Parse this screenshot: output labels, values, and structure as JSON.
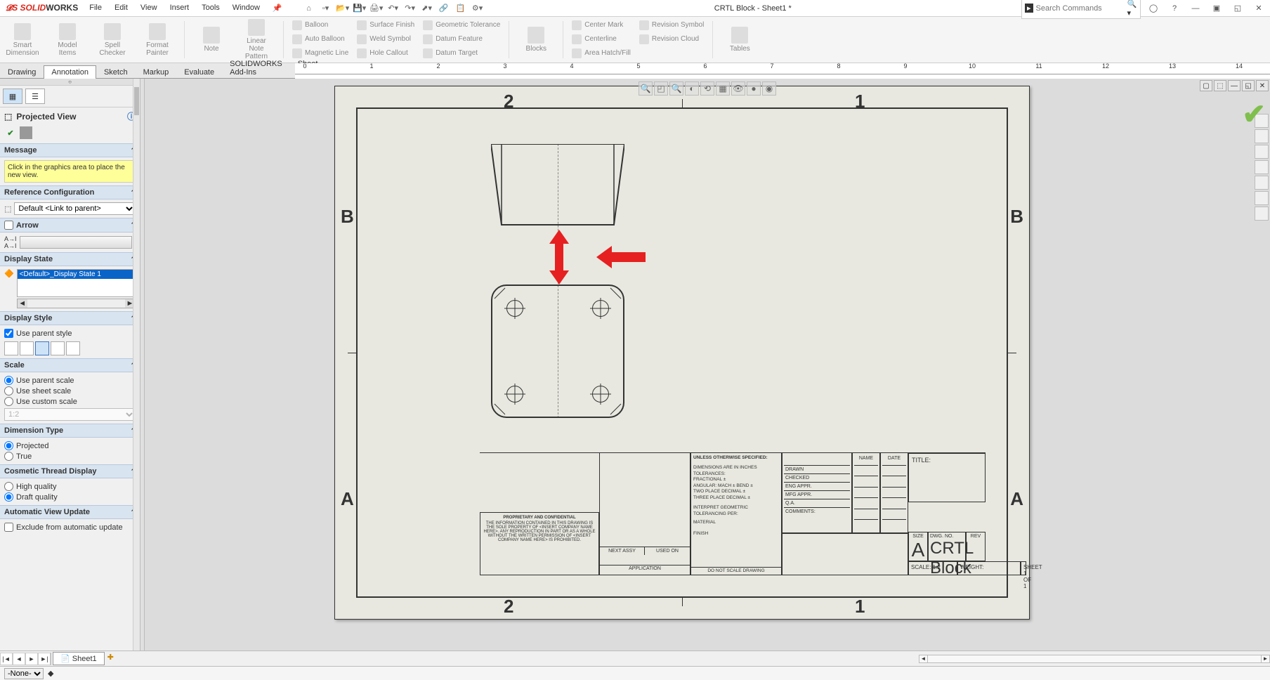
{
  "app": {
    "name_prefix": "SOLID",
    "name_suffix": "WORKS",
    "title": "CRTL Block - Sheet1 *"
  },
  "menus": {
    "file": "File",
    "edit": "Edit",
    "view": "View",
    "insert": "Insert",
    "tools": "Tools",
    "window": "Window"
  },
  "search": {
    "placeholder": "Search Commands"
  },
  "ribbon": {
    "smart_dim": "Smart Dimension",
    "model_items": "Model Items",
    "spell": "Spell Checker",
    "format": "Format Painter",
    "note": "Note",
    "linear_note": "Linear Note Pattern",
    "balloon": "Balloon",
    "auto_balloon": "Auto Balloon",
    "magnetic": "Magnetic Line",
    "surface": "Surface Finish",
    "weld": "Weld Symbol",
    "hole": "Hole Callout",
    "geo_tol": "Geometric Tolerance",
    "datum_feat": "Datum Feature",
    "datum_target": "Datum Target",
    "blocks": "Blocks",
    "center_mark": "Center Mark",
    "centerline": "Centerline",
    "area_hatch": "Area Hatch/Fill",
    "rev_symbol": "Revision Symbol",
    "rev_cloud": "Revision Cloud",
    "tables": "Tables"
  },
  "cmdtabs": {
    "drawing": "Drawing",
    "annotation": "Annotation",
    "sketch": "Sketch",
    "markup": "Markup",
    "evaluate": "Evaluate",
    "addins": "SOLIDWORKS Add-Ins",
    "sheet_format": "Sheet Format"
  },
  "prop": {
    "title": "Projected View",
    "message_head": "Message",
    "message_body": "Click in the graphics area to place the new view.",
    "ref_config_head": "Reference Configuration",
    "ref_config_val": "Default <Link to parent>",
    "arrow_head": "Arrow",
    "display_state_head": "Display State",
    "display_state_val": "<Default>_Display State 1",
    "display_style_head": "Display Style",
    "use_parent_style": "Use parent style",
    "scale_head": "Scale",
    "use_parent_scale": "Use parent scale",
    "use_sheet_scale": "Use sheet scale",
    "use_custom_scale": "Use custom scale",
    "custom_scale_val": "1:2",
    "dim_type_head": "Dimension Type",
    "projected": "Projected",
    "true": "True",
    "cosmetic_head": "Cosmetic Thread Display",
    "high_quality": "High quality",
    "draft_quality": "Draft quality",
    "auto_view_head": "Automatic View Update",
    "exclude_auto": "Exclude from automatic update"
  },
  "sheet": {
    "zone_2": "2",
    "zone_1": "1",
    "zone_b": "B",
    "zone_a": "A",
    "tb": {
      "unless": "UNLESS OTHERWISE SPECIFIED:",
      "dim_inches": "DIMENSIONS ARE IN INCHES",
      "tolerances": "TOLERANCES:",
      "fractional": "FRACTIONAL ±",
      "angular": "ANGULAR: MACH ±   BEND ±",
      "two_place": "TWO PLACE DECIMAL   ±",
      "three_place": "THREE PLACE DECIMAL  ±",
      "interpret": "INTERPRET GEOMETRIC",
      "tol_per": "TOLERANCING PER:",
      "material": "MATERIAL",
      "finish": "FINISH",
      "proprietary": "PROPRIETARY AND CONFIDENTIAL",
      "prop_body": "THE INFORMATION CONTAINED IN THIS DRAWING IS THE SOLE PROPERTY OF <INSERT COMPANY NAME HERE>. ANY REPRODUCTION IN PART OR AS A WHOLE WITHOUT THE WRITTEN PERMISSION OF <INSERT COMPANY NAME HERE> IS PROHIBITED.",
      "next_assy": "NEXT ASSY",
      "used_on": "USED ON",
      "application": "APPLICATION",
      "do_not_scale": "DO NOT SCALE DRAWING",
      "name": "NAME",
      "date": "DATE",
      "drawn": "DRAWN",
      "checked": "CHECKED",
      "eng_appr": "ENG APPR.",
      "mfg_appr": "MFG APPR.",
      "qa": "Q.A.",
      "comments": "COMMENTS:",
      "title_lbl": "TITLE:",
      "size": "SIZE",
      "size_val": "A",
      "dwg_no": "DWG.  NO.",
      "rev": "REV",
      "part_name": "CRTL Block",
      "scale": "SCALE: 1:2",
      "weight": "WEIGHT:",
      "sheet": "SHEET 1 OF 1"
    }
  },
  "tabs": {
    "sheet1": "Sheet1"
  },
  "status": {
    "none": "-None-"
  }
}
